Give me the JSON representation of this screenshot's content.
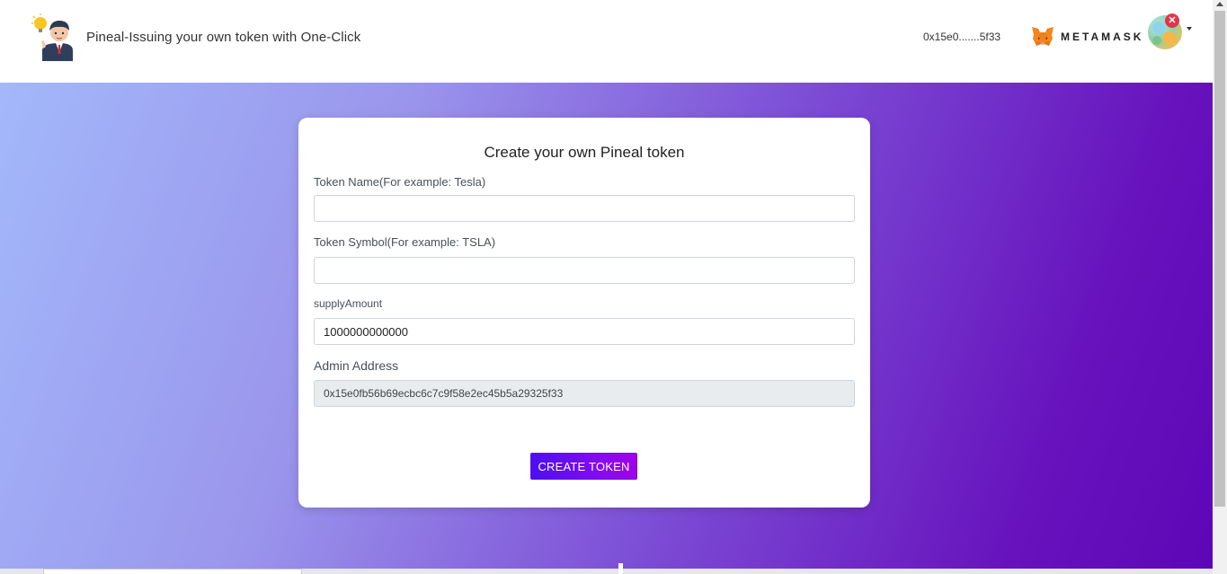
{
  "header": {
    "title": "Pineal-Issuing your own token with One-Click",
    "wallet_address_short": "0x15e0.......5f33",
    "wallet_brand": "METAMASK"
  },
  "form": {
    "title": "Create your own Pineal token",
    "token_name": {
      "label": "Token Name(For example: Tesla)",
      "value": ""
    },
    "token_symbol": {
      "label": "Token Symbol(For example: TSLA)",
      "value": ""
    },
    "supply_amount": {
      "label": "supplyAmount",
      "value": "1000000000000"
    },
    "admin_address": {
      "label": "Admin Address",
      "value": "0x15e0fb56b69ecbc6c7c9f58e2ec45b5a29325f33"
    },
    "submit_label": "CREATE TOKEN"
  },
  "colors": {
    "accent": "#5d06b6",
    "button": "#8a0af0"
  },
  "icons": {
    "logo": "businessman-lightbulb-icon",
    "wallet": "metamask-fox-icon",
    "avatar": "account-avatar-icon"
  }
}
